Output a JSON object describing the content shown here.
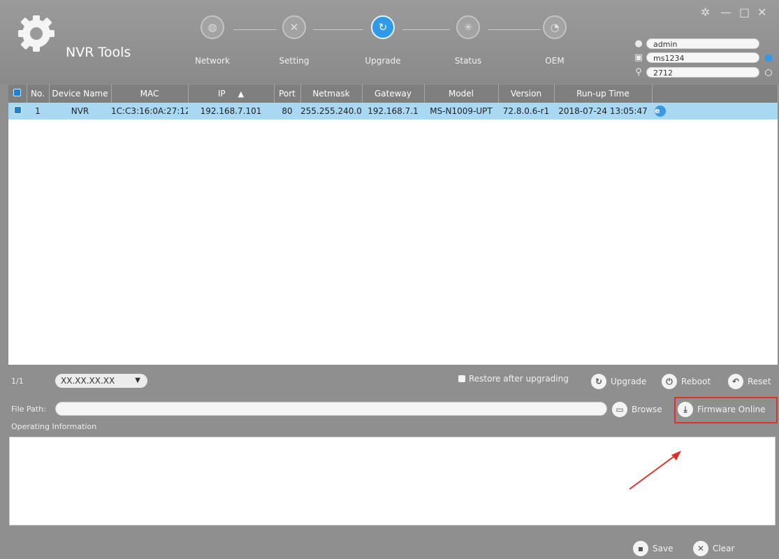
{
  "app": {
    "title": "NVR Tools"
  },
  "steps": [
    {
      "label": "Network",
      "icon": "globe-icon",
      "active": false
    },
    {
      "label": "Setting",
      "icon": "wrench-icon",
      "active": false
    },
    {
      "label": "Upgrade",
      "icon": "upgrade-icon",
      "active": true
    },
    {
      "label": "Status",
      "icon": "status-icon",
      "active": false
    },
    {
      "label": "OEM",
      "icon": "oem-icon",
      "active": false
    }
  ],
  "credentials": {
    "username": "admin",
    "password": "ms1234",
    "search": "2712"
  },
  "table": {
    "columns": [
      "No.",
      "Device Name",
      "MAC",
      "IP",
      "Port",
      "Netmask",
      "Gateway",
      "Model",
      "Version",
      "Run-up Time"
    ],
    "rows": [
      {
        "no": "1",
        "device_name": "NVR",
        "mac": "1C:C3:16:0A:27:12",
        "ip": "192.168.7.101",
        "port": "80",
        "netmask": "255.255.240.0",
        "gateway": "192.168.7.1",
        "model": "MS-N1009-UPT",
        "version": "72.8.0.6-r1",
        "runup_time": "2018-07-24 13:05:47"
      }
    ]
  },
  "pager": {
    "text": "1/1"
  },
  "version_select": {
    "value": "XX.XX.XX.XX"
  },
  "controls": {
    "restore_label": "Restore after upgrading",
    "upgrade_label": "Upgrade",
    "reboot_label": "Reboot",
    "reset_label": "Reset"
  },
  "file_path": {
    "label": "File Path:",
    "value": ""
  },
  "browse_label": "Browse",
  "firmware_online_label": "Firmware Online",
  "ops": {
    "label": "Operating Information"
  },
  "bottom": {
    "save_label": "Save",
    "clear_label": "Clear"
  },
  "colors": {
    "accent": "#2f9ae8",
    "selected_row": "#a9d8f3",
    "highlight": "#e0302a"
  }
}
